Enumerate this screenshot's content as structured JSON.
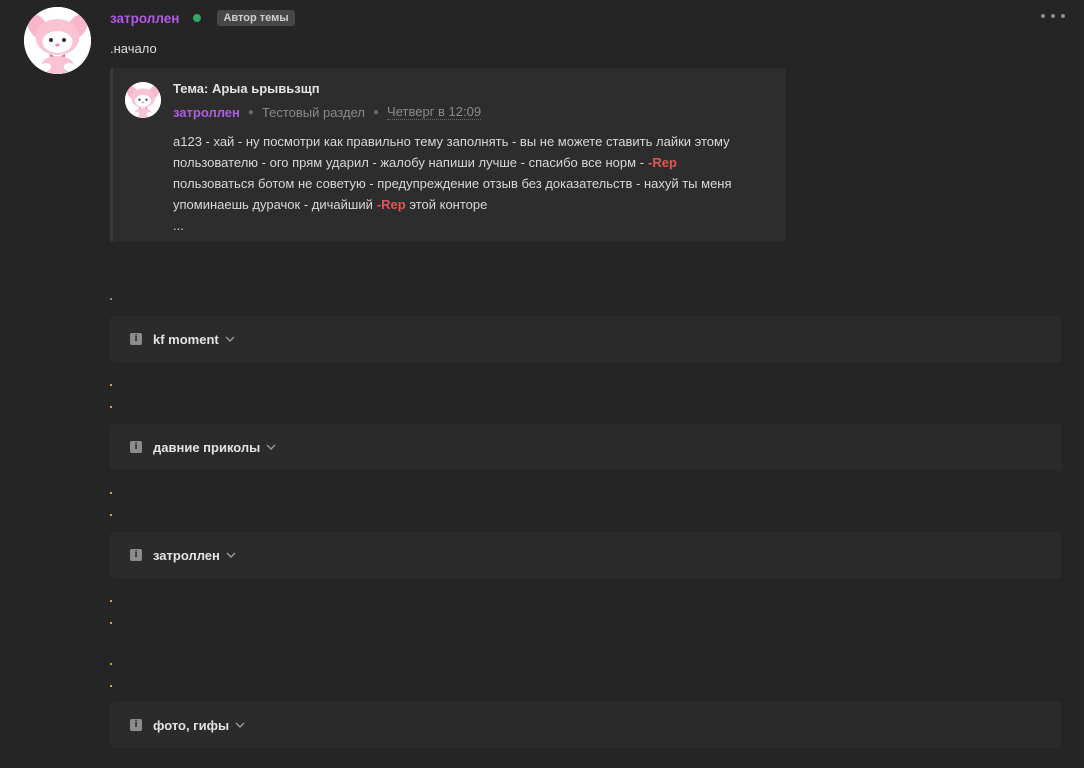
{
  "post": {
    "author": "затроллен",
    "badge": "Автор темы",
    "intro": ".начало"
  },
  "quote": {
    "title": "Тема: Арыа ьрывьзщп",
    "author": "затроллен",
    "section": "Тестовый раздел",
    "date": "Четверг в 12:09",
    "line1": "а123 - хай - ну посмотри как правильно тему заполнять - вы не можете ставить лайки этому",
    "line2": "пользователю - ого прям ударил - жалобу напиши лучше - спасибо все норм -",
    "line3": "пользоваться ботом не советую - предупреждение отзыв без доказательств - нахуй ты меня",
    "line4": "упоминаешь дурачок - дичайший",
    "line4_tail": "этой конторе",
    "rep": "-Rep",
    "ellipsis": "..."
  },
  "spoilers": [
    {
      "label": "kf moment"
    },
    {
      "label": "давние приколы"
    },
    {
      "label": "затроллен"
    },
    {
      "label": "фото, гифы"
    }
  ],
  "colors": {
    "background": "#252525",
    "author": "#b15ae8",
    "online": "#2fa866",
    "rep": "#e05555"
  },
  "icons": {
    "more": "more-horizontal-icon",
    "info": "info-icon",
    "chevron": "chevron-down-icon",
    "avatar": "pink-bunny-avatar"
  }
}
